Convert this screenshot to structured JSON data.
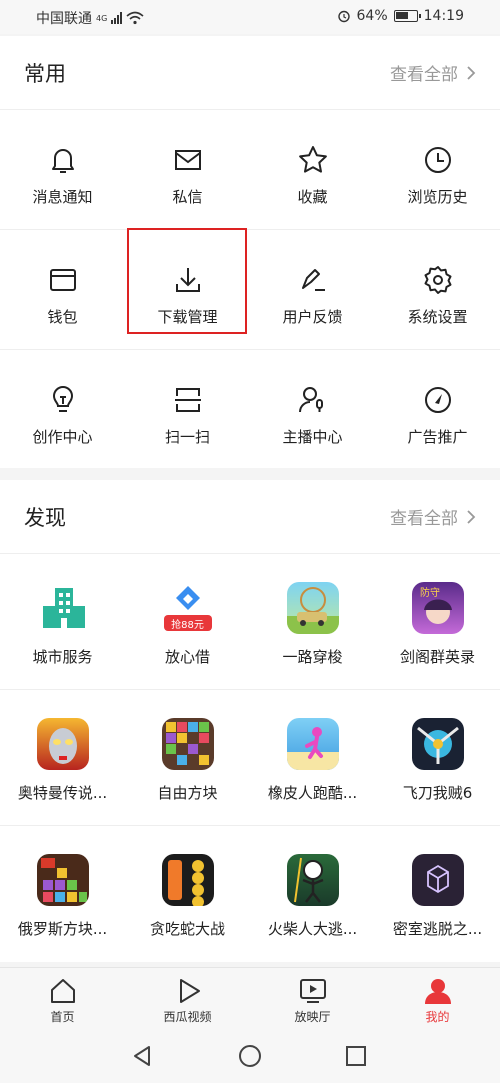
{
  "status_bar": {
    "carrier": "中国联通",
    "network": "4G",
    "alarm_icon": "alarm-icon",
    "battery": "64%",
    "battery_level": 0.64,
    "time": "14:19"
  },
  "common": {
    "title": "常用",
    "view_all": "查看全部",
    "items": [
      {
        "label": "消息通知",
        "icon": "bell-icon"
      },
      {
        "label": "私信",
        "icon": "mail-icon"
      },
      {
        "label": "收藏",
        "icon": "star-icon"
      },
      {
        "label": "浏览历史",
        "icon": "clock-icon"
      },
      {
        "label": "钱包",
        "icon": "wallet-icon"
      },
      {
        "label": "下载管理",
        "icon": "download-icon"
      },
      {
        "label": "用户反馈",
        "icon": "pen-icon"
      },
      {
        "label": "系统设置",
        "icon": "gear-icon"
      },
      {
        "label": "创作中心",
        "icon": "bulb-icon"
      },
      {
        "label": "扫一扫",
        "icon": "scan-icon"
      },
      {
        "label": "主播中心",
        "icon": "anchor-icon"
      },
      {
        "label": "广告推广",
        "icon": "compass-icon"
      }
    ]
  },
  "discover": {
    "title": "发现",
    "view_all": "查看全部",
    "items": [
      {
        "label": "城市服务",
        "icon": "city-buildings-icon"
      },
      {
        "label": "放心借",
        "icon": "loan-app-icon",
        "badge": "抢88元"
      },
      {
        "label": "一路穿梭",
        "icon": "racing-game-icon"
      },
      {
        "label": "剑阁群英录",
        "icon": "anime-game-icon"
      },
      {
        "label": "奥特曼传说...",
        "icon": "ultraman-game-icon"
      },
      {
        "label": "自由方块",
        "icon": "block-puzzle-icon"
      },
      {
        "label": "橡皮人跑酷...",
        "icon": "runner-game-icon"
      },
      {
        "label": "飞刀我贼6",
        "icon": "knife-game-icon"
      },
      {
        "label": "俄罗斯方块...",
        "icon": "tetris-game-icon"
      },
      {
        "label": "贪吃蛇大战",
        "icon": "snake-game-icon"
      },
      {
        "label": "火柴人大逃...",
        "icon": "stickman-game-icon"
      },
      {
        "label": "密室逃脱之...",
        "icon": "escape-room-icon"
      }
    ]
  },
  "tabs": [
    {
      "label": "首页",
      "icon": "home-icon"
    },
    {
      "label": "西瓜视频",
      "icon": "play-icon"
    },
    {
      "label": "放映厅",
      "icon": "tv-icon"
    },
    {
      "label": "我的",
      "icon": "user-icon",
      "active": true
    }
  ],
  "colors": {
    "accent": "#e8373a",
    "highlight_box": "#dd2222"
  }
}
